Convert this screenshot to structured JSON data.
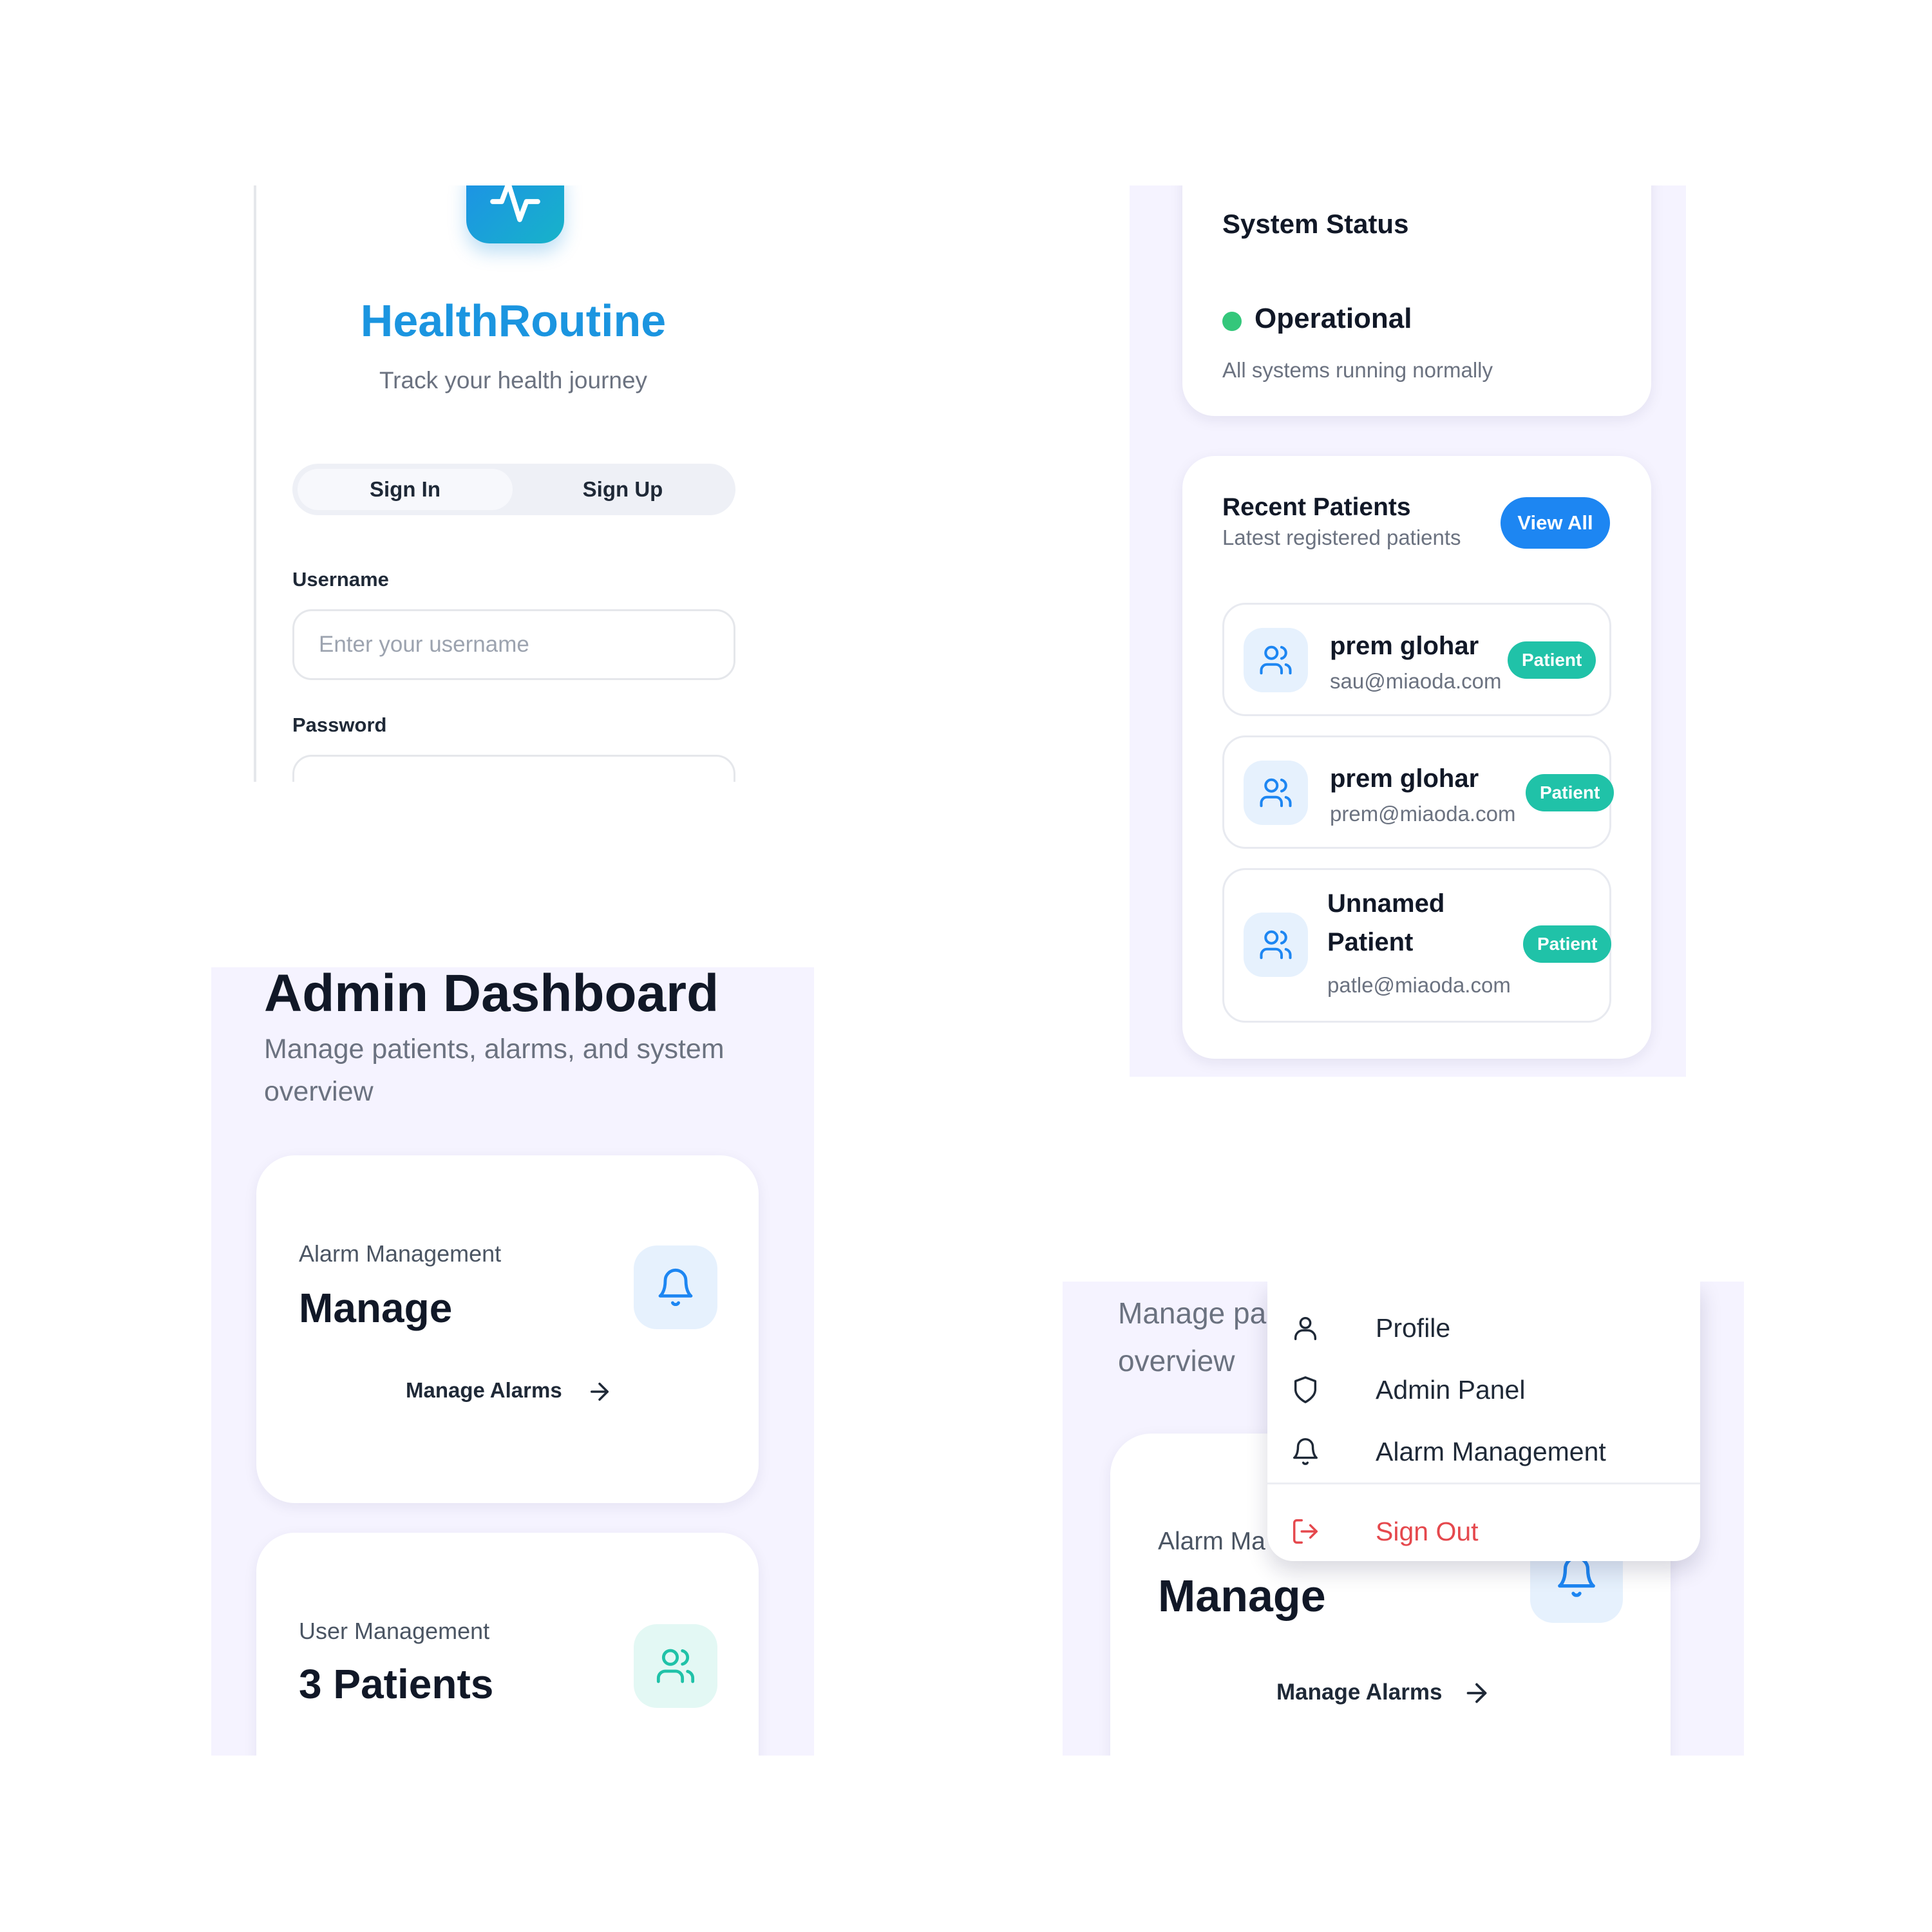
{
  "login": {
    "app_title": "HealthRoutine",
    "tagline": "Track your health journey",
    "tabs": [
      "Sign In",
      "Sign Up"
    ],
    "username_label": "Username",
    "username_placeholder": "Enter your username",
    "password_label": "Password"
  },
  "status": {
    "title": "System Status",
    "state": "Operational",
    "description": "All systems running normally"
  },
  "recent_patients": {
    "title": "Recent Patients",
    "subtitle": "Latest registered patients",
    "view_all": "View All",
    "items": [
      {
        "name_line1": "prem glohar",
        "name_line2": "",
        "email": "sau@miaoda.com",
        "badge": "Patient"
      },
      {
        "name_line1": "prem glohar",
        "name_line2": "",
        "email": "prem@miaoda.com",
        "badge": "Patient"
      },
      {
        "name_line1": "Unnamed",
        "name_line2": "Patient",
        "email": "patle@miaoda.com",
        "badge": "Patient"
      }
    ]
  },
  "dashboard": {
    "title": "Admin Dashboard",
    "subtitle": "Manage patients, alarms, and system overview",
    "cards": [
      {
        "label": "Alarm Management",
        "value": "Manage",
        "link": "Manage Alarms"
      },
      {
        "label": "User Management",
        "value": "3 Patients"
      }
    ]
  },
  "menu_view": {
    "subtitle_line1": "Manage pa",
    "subtitle_line2": "overview",
    "card_label": "Alarm Ma",
    "card_value": "Manage",
    "card_link": "Manage Alarms",
    "menu_items": [
      "Profile",
      "Admin Panel",
      "Alarm Management"
    ],
    "sign_out": "Sign Out"
  },
  "colors": {
    "brand_blue": "#1b95e0",
    "button_blue": "#1d86f2",
    "badge_teal": "#20c2a8",
    "status_green": "#34c77b",
    "danger_red": "#e5484d",
    "panel_lavender": "#f5f3ff"
  },
  "icons": {
    "logo": "pulse-icon",
    "patient": "users-icon",
    "alarm": "bell-icon",
    "link": "arrow-right-icon",
    "profile": "user-icon",
    "admin": "shield-icon",
    "sign_out": "logout-icon"
  }
}
